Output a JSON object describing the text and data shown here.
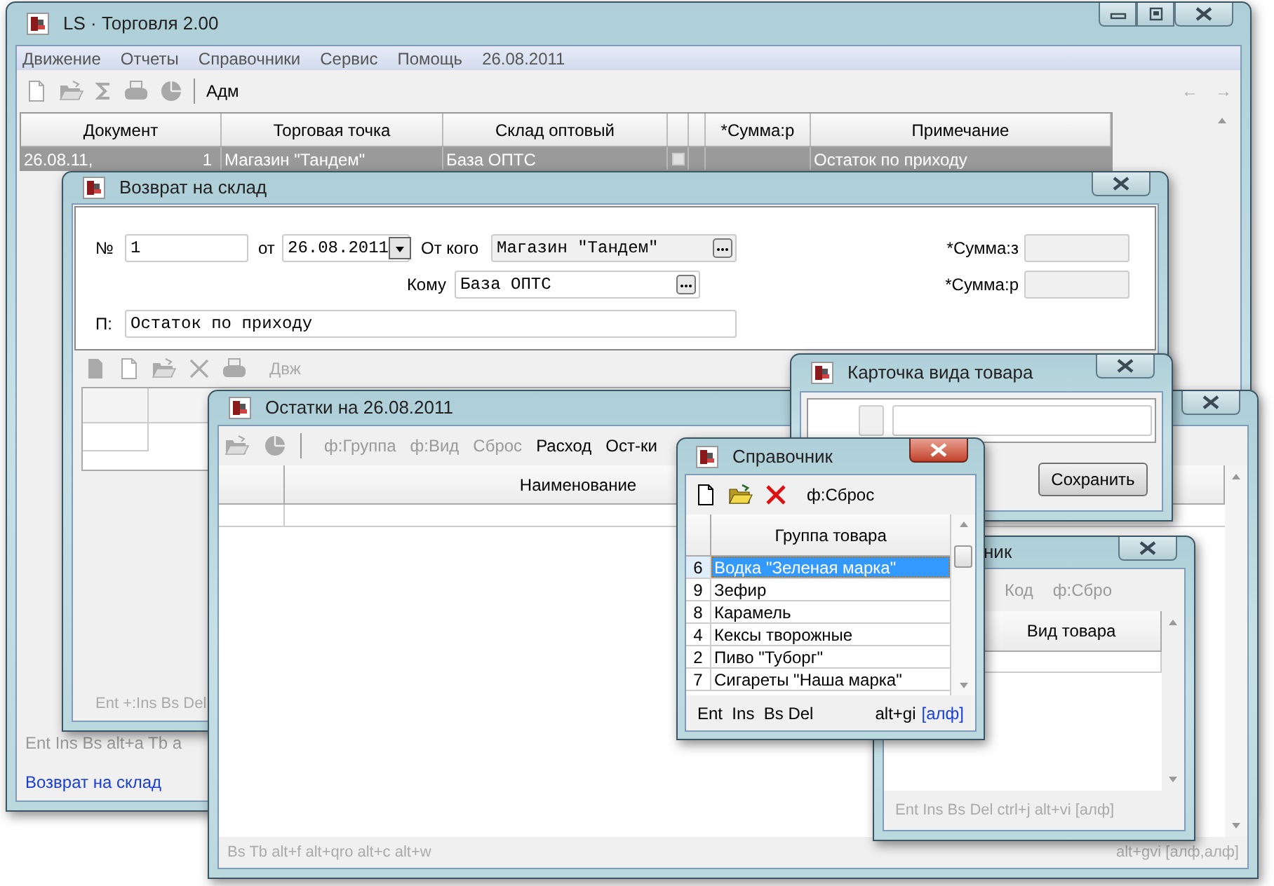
{
  "main_window": {
    "title": "LS · Торговля 2.00",
    "menu": [
      "Движение",
      "Отчеты",
      "Справочники",
      "Сервис",
      "Помощь",
      "26.08.2011"
    ],
    "toolbar_label": "Адм",
    "nav": [
      "←",
      "→"
    ],
    "columns": {
      "document": "Документ",
      "outlet": "Торговая точка",
      "warehouse": "Склад оптовый",
      "sum": "*Сумма:р",
      "note": "Примечание"
    },
    "rows": [
      {
        "document": "26.08.11,",
        "number": "1",
        "outlet": "Магазин \"Тандем\"",
        "warehouse": "База ОПТС",
        "checked": false,
        "note": "Остаток по приходу",
        "selected": true
      }
    ],
    "status_hints": "Ent Ins Bs alt+a Tb a",
    "status_title": "Возврат на склад"
  },
  "return_window": {
    "title": "Возврат на склад",
    "number_label": "№",
    "number": "1",
    "date_label": "от",
    "date": "26.08.2011",
    "from_label": "От кого",
    "from": "Магазин \"Тандем\"",
    "to_label": "Кому",
    "to": "База ОПТС",
    "note_label": "П:",
    "note": "Остаток по приходу",
    "sum_labels": [
      "*Сумма:з",
      "*Сумма:р"
    ],
    "toolbar_label": "Двж",
    "footer": "Ent +:Ins Bs Del"
  },
  "stock_window": {
    "title": "Остатки на  26.08.2011",
    "toolbar": [
      {
        "label": "ф:Группа",
        "disabled": true
      },
      {
        "label": "ф:Вид",
        "disabled": true
      },
      {
        "label": "Сброс",
        "disabled": true
      },
      {
        "label": "Расход",
        "disabled": false
      },
      {
        "label": "Ост-ки",
        "disabled": false
      }
    ],
    "column": "Наименование",
    "footer_left": "Bs Tb alt+f alt+qro alt+c alt+w",
    "footer_right": "alt+gvi [алф,алф]"
  },
  "card_window": {
    "title": "Карточка вида товара",
    "save": "Сохранить"
  },
  "type_window": {
    "title": "ник",
    "toolbar": [
      {
        "label": "Код",
        "disabled": true
      },
      {
        "label": "ф:Сбро",
        "disabled": true
      }
    ],
    "column": "Вид товара",
    "footer": "Ent Ins Bs Del ctrl+j alt+vi [алф]"
  },
  "group_window": {
    "title": "Справочник",
    "filter": "ф:Сброс",
    "column": "Группа товара",
    "rows": [
      {
        "code": "6",
        "name": "Водка \"Зеленая марка\"",
        "selected": true
      },
      {
        "code": "9",
        "name": "Зефир",
        "selected": false
      },
      {
        "code": "8",
        "name": "Карамель",
        "selected": false
      },
      {
        "code": "4",
        "name": "Кексы творожные",
        "selected": false
      },
      {
        "code": "2",
        "name": "Пиво \"Туборг\"",
        "selected": false
      },
      {
        "code": "7",
        "name": "Сигареты \"Наша марка\"",
        "selected": false
      }
    ],
    "footer_keys": "Ent  Ins  Bs Del",
    "footer_shortcut": "alt+gi",
    "footer_mode": "[алф]"
  }
}
